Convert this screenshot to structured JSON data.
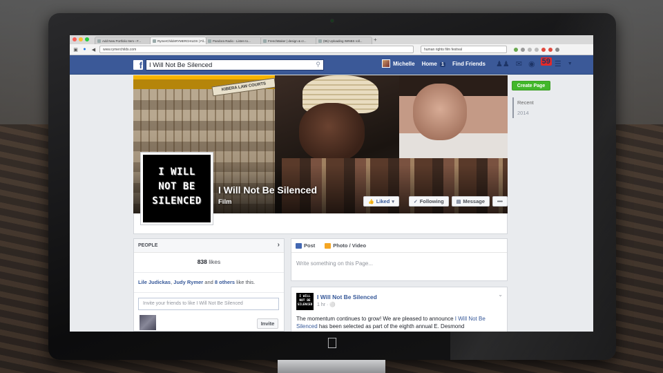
{
  "browser": {
    "tabs": [
      {
        "label": "Add New Portfolio Item ‹ F..."
      },
      {
        "label": "RymerChildsRYMERCHILDS | Fil...",
        "active": true
      },
      {
        "label": "Pandora Radio - Listen to..."
      },
      {
        "label": "FrenchBaker | design & cr..."
      },
      {
        "label": "(95) Uploading IWNBS roll..."
      }
    ],
    "url": "www.rymerchilds.com",
    "search_text": "human rights film festival",
    "new_tab_label": "+"
  },
  "facebook": {
    "logo_letter": "f",
    "search_value": "I Will Not Be Silenced",
    "nav": {
      "user": "Michelle",
      "home": "Home",
      "home_count": "1",
      "find_friends": "Find Friends",
      "notification_count": "59"
    }
  },
  "page": {
    "cover_sign_text": "KIBERA LAW COURTS",
    "profile_logo_lines": [
      "I WILL",
      "NOT BE",
      "SILENCED"
    ],
    "name": "I Will Not Be Silenced",
    "category": "Film",
    "buttons": {
      "liked": "Liked",
      "following": "Following",
      "message": "Message",
      "more": "•••"
    },
    "create_page": "Create Page",
    "timeline_years": [
      "Recent",
      "2014"
    ]
  },
  "people": {
    "header": "PEOPLE",
    "likes_count": "838",
    "likes_word": "likes",
    "friend1": "Lile Judickas",
    "friend_sep": ", ",
    "friend2": "Judy Rymer",
    "and_text": " and ",
    "others": "8 others",
    "like_this": " like this.",
    "invite_placeholder": "Invite your friends to like I Will Not Be Silenced",
    "invite_button": "Invite"
  },
  "composer": {
    "tab_post": "Post",
    "tab_photo": "Photo / Video",
    "placeholder": "Write something on this Page..."
  },
  "post": {
    "author": "I Will Not Be Silenced",
    "time": "1 hr · ",
    "text_before": "The momentum continues to grow! We are pleased to announce ",
    "link_text": "I Will Not Be Silenced",
    "text_after": " has been selected as part of the eighth annual E. Desmond"
  },
  "colors": {
    "facebook_blue": "#3b5998",
    "create_green": "#42b72a",
    "notification_red": "#e32a2a"
  }
}
